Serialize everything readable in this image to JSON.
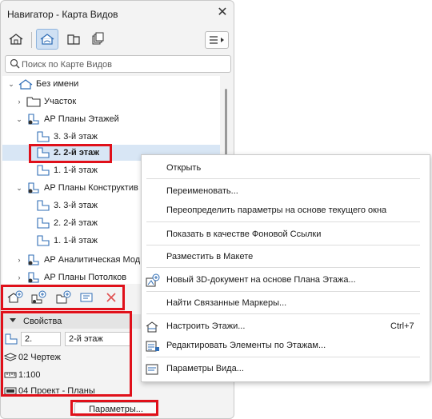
{
  "window": {
    "title": "Навигатор - Карта Видов",
    "close_icon": "close-icon"
  },
  "search": {
    "placeholder": "Поиск по Карте Видов"
  },
  "tree": [
    {
      "label": "Без имени"
    },
    {
      "label": "Участок"
    },
    {
      "label": "АР Планы Этажей"
    },
    {
      "label": "3. 3-й этаж"
    },
    {
      "label": "2. 2-й этаж"
    },
    {
      "label": "1. 1-й этаж"
    },
    {
      "label": "АР Планы Конструктив"
    },
    {
      "label": "3. 3-й этаж"
    },
    {
      "label": "2. 2-й этаж"
    },
    {
      "label": "1. 1-й этаж"
    },
    {
      "label": "АР Аналитическая Мод"
    },
    {
      "label": "АР Планы Потолков"
    }
  ],
  "properties": {
    "header": "Свойства",
    "id_value": "2.",
    "name_value": "2-й этаж",
    "layer_combination": "02 Чертеж",
    "scale": "1:100",
    "pen_set": "04 Проект - Планы"
  },
  "params_button": "Параметры...",
  "context_menu": {
    "items": [
      {
        "label": "Открыть",
        "shortcut": ""
      },
      {
        "label": "Переименовать...",
        "shortcut": ""
      },
      {
        "label": "Переопределить параметры на основе текущего окна",
        "shortcut": ""
      },
      {
        "label": "Показать в качестве Фоновой Ссылки",
        "shortcut": ""
      },
      {
        "label": "Разместить в Макете",
        "shortcut": ""
      },
      {
        "label": "Новый 3D-документ на основе Плана Этажа...",
        "shortcut": ""
      },
      {
        "label": "Найти Связанные Маркеры...",
        "shortcut": ""
      },
      {
        "label": "Настроить Этажи...",
        "shortcut": "Ctrl+7"
      },
      {
        "label": "Редактировать Элементы по Этажам...",
        "shortcut": ""
      },
      {
        "label": "Параметры Вида...",
        "shortcut": ""
      }
    ]
  },
  "colors": {
    "accent": "#2f6db5",
    "selection": "#d8e6f5",
    "highlight_border": "#e0101a",
    "delete_icon": "#e05050"
  }
}
